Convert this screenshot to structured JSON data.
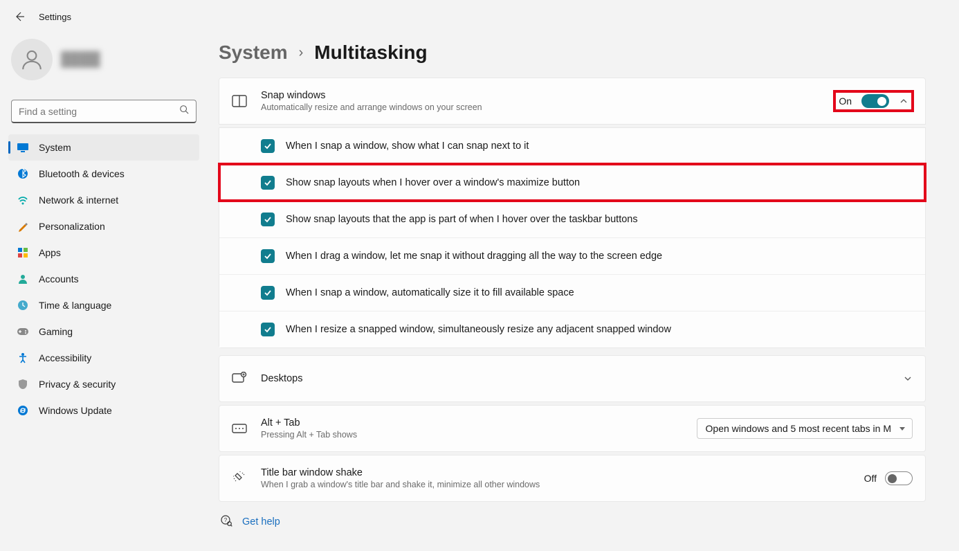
{
  "app_title": "Settings",
  "search_placeholder": "Find a setting",
  "nav": [
    {
      "label": "System",
      "icon": "system",
      "active": true
    },
    {
      "label": "Bluetooth & devices",
      "icon": "bluetooth"
    },
    {
      "label": "Network & internet",
      "icon": "network"
    },
    {
      "label": "Personalization",
      "icon": "personalization"
    },
    {
      "label": "Apps",
      "icon": "apps"
    },
    {
      "label": "Accounts",
      "icon": "accounts"
    },
    {
      "label": "Time & language",
      "icon": "time"
    },
    {
      "label": "Gaming",
      "icon": "gaming"
    },
    {
      "label": "Accessibility",
      "icon": "accessibility"
    },
    {
      "label": "Privacy & security",
      "icon": "privacy"
    },
    {
      "label": "Windows Update",
      "icon": "update"
    }
  ],
  "breadcrumb": {
    "parent": "System",
    "current": "Multitasking"
  },
  "snap": {
    "title": "Snap windows",
    "subtitle": "Automatically resize and arrange windows on your screen",
    "state_label": "On",
    "options": [
      {
        "label": "When I snap a window, show what I can snap next to it",
        "checked": true
      },
      {
        "label": "Show snap layouts when I hover over a window's maximize button",
        "checked": true,
        "highlighted": true
      },
      {
        "label": "Show snap layouts that the app is part of when I hover over the taskbar buttons",
        "checked": true
      },
      {
        "label": "When I drag a window, let me snap it without dragging all the way to the screen edge",
        "checked": true
      },
      {
        "label": "When I snap a window, automatically size it to fill available space",
        "checked": true
      },
      {
        "label": "When I resize a snapped window, simultaneously resize any adjacent snapped window",
        "checked": true
      }
    ]
  },
  "desktops": {
    "title": "Desktops"
  },
  "alttab": {
    "title": "Alt + Tab",
    "subtitle": "Pressing Alt + Tab shows",
    "selected": "Open windows and 5 most recent tabs in M"
  },
  "shake": {
    "title": "Title bar window shake",
    "subtitle": "When I grab a window's title bar and shake it, minimize all other windows",
    "state_label": "Off"
  },
  "help": "Get help"
}
